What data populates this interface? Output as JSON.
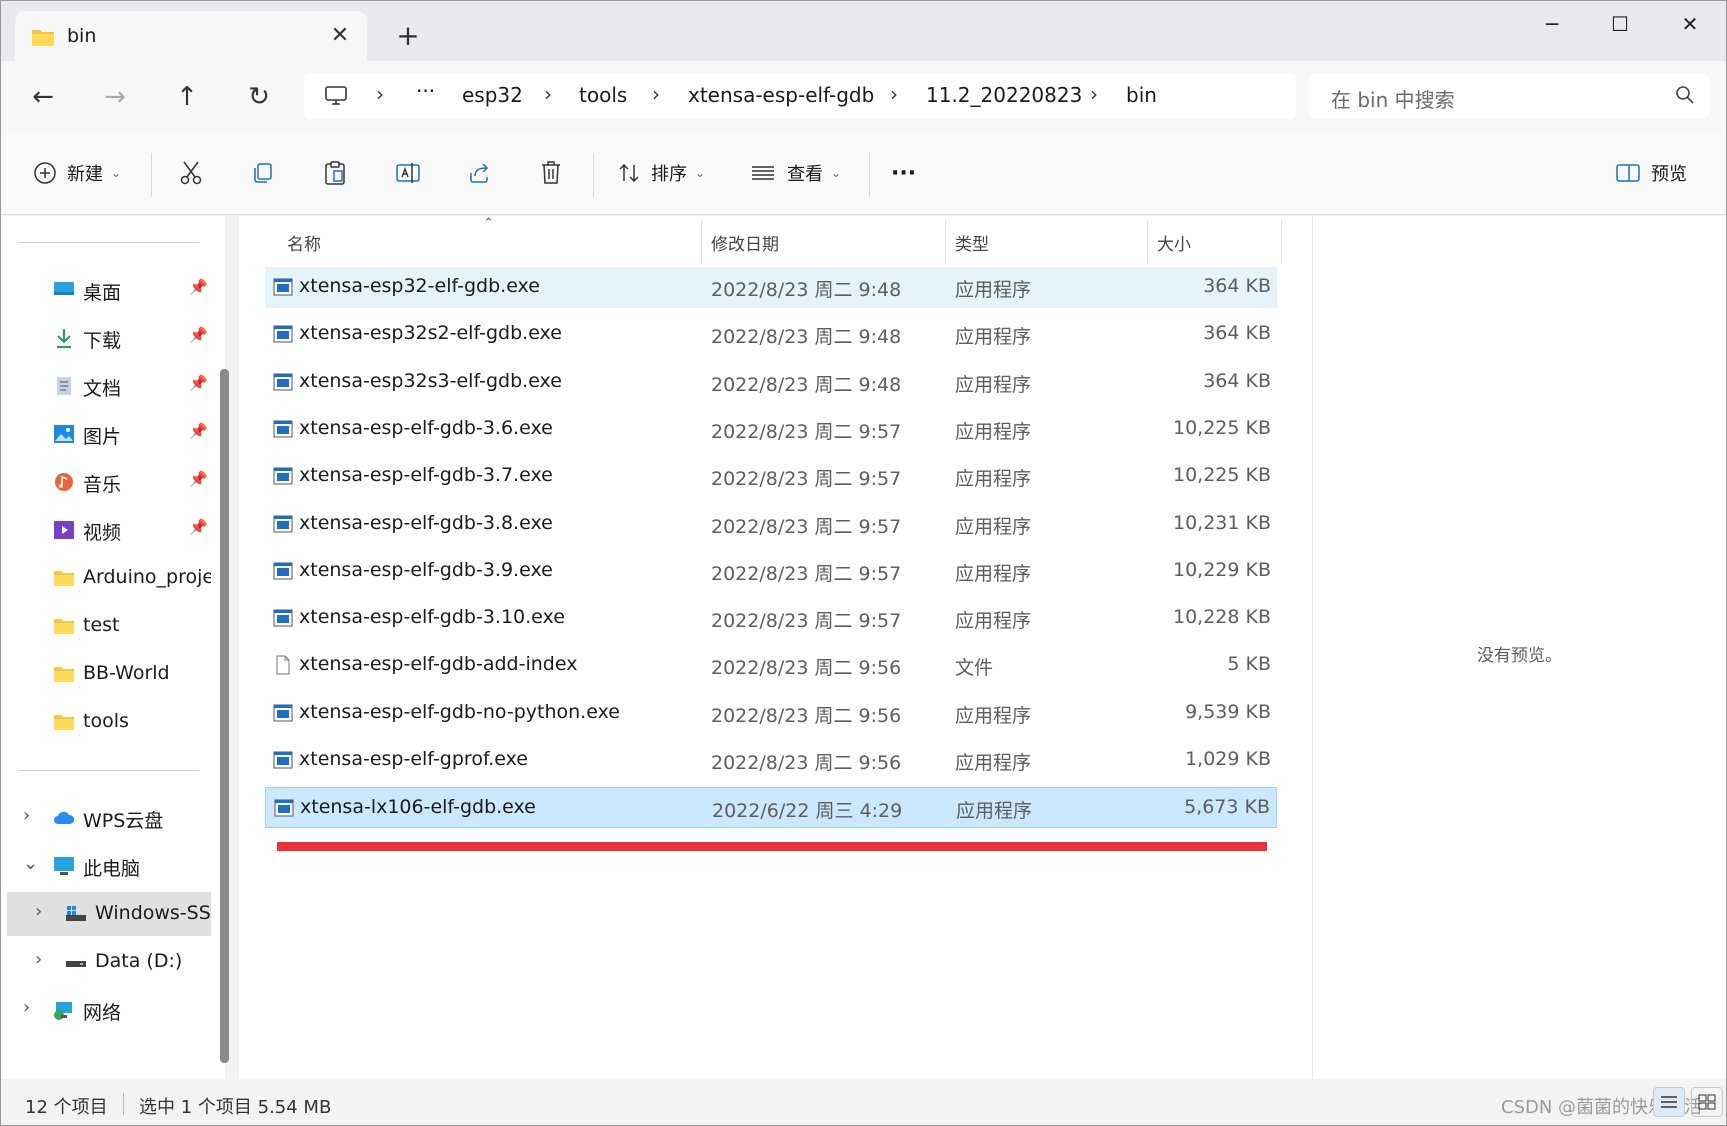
{
  "tab": {
    "title": "bin"
  },
  "window": {
    "minimize": "─",
    "maximize": "☐",
    "close": "✕",
    "new_tab": "+"
  },
  "nav": {
    "back": "←",
    "forward": "→",
    "up": "↑",
    "refresh": "↻",
    "more_crumbs": "···",
    "breadcrumb": [
      "esp32",
      "tools",
      "xtensa-esp-elf-gdb",
      "11.2_20220823",
      "bin"
    ],
    "search_placeholder": "在 bin 中搜索"
  },
  "toolbar": {
    "new_label": "新建",
    "sort_label": "排序",
    "view_label": "查看",
    "more_label": "···",
    "preview_label": "预览"
  },
  "sidebar": {
    "quick_access": [
      {
        "label": "桌面",
        "icon": "desktop-icon",
        "pinned": true
      },
      {
        "label": "下载",
        "icon": "download-icon",
        "pinned": true
      },
      {
        "label": "文档",
        "icon": "document-icon",
        "pinned": true
      },
      {
        "label": "图片",
        "icon": "pictures-icon",
        "pinned": true
      },
      {
        "label": "音乐",
        "icon": "music-icon",
        "pinned": true
      },
      {
        "label": "视频",
        "icon": "video-icon",
        "pinned": true
      },
      {
        "label": "Arduino_projects",
        "icon": "folder-icon",
        "pinned": false
      },
      {
        "label": "test",
        "icon": "folder-icon",
        "pinned": false
      },
      {
        "label": "BB-World",
        "icon": "folder-icon",
        "pinned": false
      },
      {
        "label": "tools",
        "icon": "folder-icon",
        "pinned": false
      }
    ],
    "tree": [
      {
        "label": "WPS云盘",
        "icon": "cloud-icon",
        "chevron": "›"
      },
      {
        "label": "此电脑",
        "icon": "computer-icon",
        "chevron": "⌄"
      },
      {
        "label": "Windows-SSD (C:)",
        "icon": "drive-c-icon",
        "chevron": "›"
      },
      {
        "label": "Data (D:)",
        "icon": "drive-d-icon",
        "chevron": "›"
      },
      {
        "label": "网络",
        "icon": "network-icon",
        "chevron": "›"
      }
    ]
  },
  "columns": {
    "name": "名称",
    "date": "修改日期",
    "type": "类型",
    "size": "大小"
  },
  "files": [
    {
      "name": "xtensa-esp32-elf-gdb.exe",
      "date": "2022/8/23 周二 9:48",
      "type": "应用程序",
      "size": "364 KB",
      "kind": "exe"
    },
    {
      "name": "xtensa-esp32s2-elf-gdb.exe",
      "date": "2022/8/23 周二 9:48",
      "type": "应用程序",
      "size": "364 KB",
      "kind": "exe"
    },
    {
      "name": "xtensa-esp32s3-elf-gdb.exe",
      "date": "2022/8/23 周二 9:48",
      "type": "应用程序",
      "size": "364 KB",
      "kind": "exe"
    },
    {
      "name": "xtensa-esp-elf-gdb-3.6.exe",
      "date": "2022/8/23 周二 9:57",
      "type": "应用程序",
      "size": "10,225 KB",
      "kind": "exe"
    },
    {
      "name": "xtensa-esp-elf-gdb-3.7.exe",
      "date": "2022/8/23 周二 9:57",
      "type": "应用程序",
      "size": "10,225 KB",
      "kind": "exe"
    },
    {
      "name": "xtensa-esp-elf-gdb-3.8.exe",
      "date": "2022/8/23 周二 9:57",
      "type": "应用程序",
      "size": "10,231 KB",
      "kind": "exe"
    },
    {
      "name": "xtensa-esp-elf-gdb-3.9.exe",
      "date": "2022/8/23 周二 9:57",
      "type": "应用程序",
      "size": "10,229 KB",
      "kind": "exe"
    },
    {
      "name": "xtensa-esp-elf-gdb-3.10.exe",
      "date": "2022/8/23 周二 9:57",
      "type": "应用程序",
      "size": "10,228 KB",
      "kind": "exe"
    },
    {
      "name": "xtensa-esp-elf-gdb-add-index",
      "date": "2022/8/23 周二 9:56",
      "type": "文件",
      "size": "5 KB",
      "kind": "file"
    },
    {
      "name": "xtensa-esp-elf-gdb-no-python.exe",
      "date": "2022/8/23 周二 9:56",
      "type": "应用程序",
      "size": "9,539 KB",
      "kind": "exe"
    },
    {
      "name": "xtensa-esp-elf-gprof.exe",
      "date": "2022/8/23 周二 9:56",
      "type": "应用程序",
      "size": "1,029 KB",
      "kind": "exe"
    },
    {
      "name": "xtensa-lx106-elf-gdb.exe",
      "date": "2022/6/22 周三 4:29",
      "type": "应用程序",
      "size": "5,673 KB",
      "kind": "exe"
    }
  ],
  "preview": {
    "message": "没有预览。"
  },
  "status": {
    "count": "12 个项目",
    "selection": "选中 1 个项目  5.54 MB",
    "watermark": "CSDN @菌菌的快乐生活"
  },
  "colors": {
    "selection": "#cce8ff",
    "hover": "#e5f3fb",
    "annotation": "#e8323a",
    "folder": "#f4c542",
    "exe": "#1e6fc2"
  }
}
